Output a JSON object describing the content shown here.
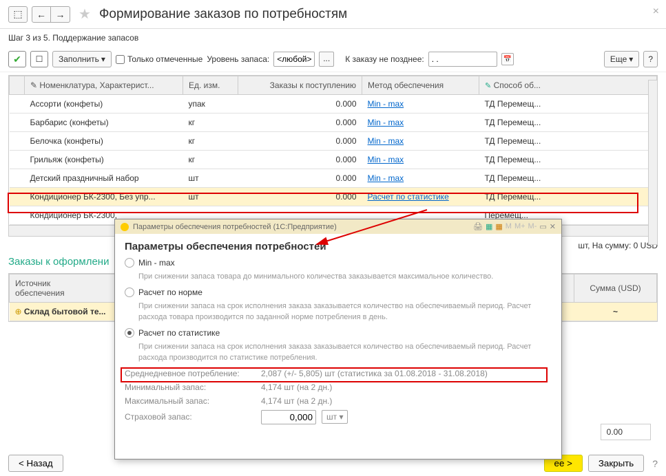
{
  "header": {
    "title": "Формирование заказов по потребностям"
  },
  "step_text": "Шаг 3 из 5. Поддержание запасов",
  "toolbar": {
    "fill_btn": "Заполнить",
    "only_marked": "Только отмеченные",
    "level_label": "Уровень запаса:",
    "level_value": "<любой>",
    "deadline_label": "К заказу не позднее:",
    "deadline_value": ". .",
    "more_btn": "Еще"
  },
  "columns": {
    "c0": "",
    "c1": "Номенклатура, Характерист...",
    "c2": "Ед. изм.",
    "c3": "Заказы к поступлению",
    "c4": "Метод обеспечения",
    "c5": "Способ об..."
  },
  "rows": [
    {
      "name": "Ассорти (конфеты)",
      "unit": "упак",
      "qty": "0.000",
      "method": "Min - max",
      "supply": "ТД Перемещ..."
    },
    {
      "name": "Барбарис (конфеты)",
      "unit": "кг",
      "qty": "0.000",
      "method": "Min - max",
      "supply": "ТД Перемещ..."
    },
    {
      "name": "Белочка (конфеты)",
      "unit": "кг",
      "qty": "0.000",
      "method": "Min - max",
      "supply": "ТД Перемещ..."
    },
    {
      "name": "Грильяж (конфеты)",
      "unit": "кг",
      "qty": "0.000",
      "method": "Min - max",
      "supply": "ТД Перемещ..."
    },
    {
      "name": "Детский праздничный набор",
      "unit": "шт",
      "qty": "0.000",
      "method": "Min - max",
      "supply": "ТД Перемещ..."
    },
    {
      "name": "Кондиционер БК-2300, Без упр...",
      "unit": "шт",
      "qty": "0.000",
      "method": "Расчет по статистике",
      "supply": "ТД Перемещ..."
    },
    {
      "name": "Кондиционер БК-2300,",
      "unit": "",
      "qty": "",
      "method": "",
      "supply": "Перемещ..."
    }
  ],
  "totals": "шт, На сумму: 0 USD",
  "section": "Заказы к оформлени",
  "sub_header": {
    "src": "Источник\nобеспечения",
    "sum": "Сумма (USD)"
  },
  "sub_row": {
    "name": "Склад бытовой те...",
    "val": "~"
  },
  "sum_box": "0.00",
  "footer": {
    "back": "< Назад",
    "next": "ее >",
    "close": "Закрыть"
  },
  "popup": {
    "wintitle": "Параметры обеспечения потребностей (1С:Предприятие)",
    "title": "Параметры обеспечения потребностей",
    "opt1": "Min - max",
    "hint1": "При снижении запаса товара до минимального количества заказывается максимальное количество.",
    "opt2": "Расчет по норме",
    "hint2": "При снижении запаса на срок исполнения заказа заказывается количество на обеспечиваемый период. Расчет расхода товара производится по заданной норме потребления в день.",
    "opt3": "Расчет по статистике",
    "hint3": "При снижении запаса на срок исполнения заказа заказывается количество на обеспечиваемый период. Расчет расхода производится по статистике потребления.",
    "p1_lbl": "Среднедневное потребление:",
    "p1_val": "2,087 (+/- 5,805) шт (статистика за 01.08.2018 - 31.08.2018)",
    "p2_lbl": "Минимальный запас:",
    "p2_val": "4,174 шт (на 2 дн.)",
    "p3_lbl": "Максимальный запас:",
    "p3_val": "4,174 шт (на 2 дн.)",
    "p4_lbl": "Страховой запас:",
    "p4_val": "0,000",
    "p4_unit": "шт"
  }
}
